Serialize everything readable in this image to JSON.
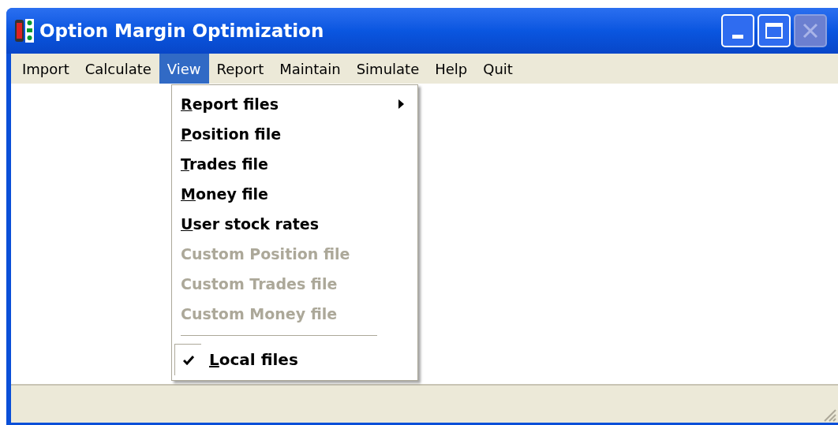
{
  "window": {
    "title": "Option Margin Optimization"
  },
  "menu_bar": [
    {
      "label": "Import",
      "selected": false
    },
    {
      "label": "Calculate",
      "selected": false
    },
    {
      "label": "View",
      "selected": true
    },
    {
      "label": "Report",
      "selected": false
    },
    {
      "label": "Maintain",
      "selected": false
    },
    {
      "label": "Simulate",
      "selected": false
    },
    {
      "label": "Help",
      "selected": false
    },
    {
      "label": "Quit",
      "selected": false
    }
  ],
  "view_menu": [
    {
      "kind": "submenu",
      "label": "Report files",
      "disabled": false,
      "underline_first": true
    },
    {
      "kind": "item",
      "label": "Position file",
      "disabled": false,
      "underline_first": true
    },
    {
      "kind": "item",
      "label": "Trades file",
      "disabled": false,
      "underline_first": true
    },
    {
      "kind": "item",
      "label": "Money file",
      "disabled": false,
      "underline_first": true
    },
    {
      "kind": "item",
      "label": "User stock rates",
      "disabled": false,
      "underline_first": true
    },
    {
      "kind": "item",
      "label": "Custom Position file",
      "disabled": true,
      "underline_first": false
    },
    {
      "kind": "item",
      "label": "Custom Trades file",
      "disabled": true,
      "underline_first": false
    },
    {
      "kind": "item",
      "label": "Custom Money file",
      "disabled": true,
      "underline_first": false
    },
    {
      "kind": "separator"
    },
    {
      "kind": "check",
      "label": "Local files",
      "checked": true,
      "disabled": false,
      "underline_first": true
    }
  ]
}
